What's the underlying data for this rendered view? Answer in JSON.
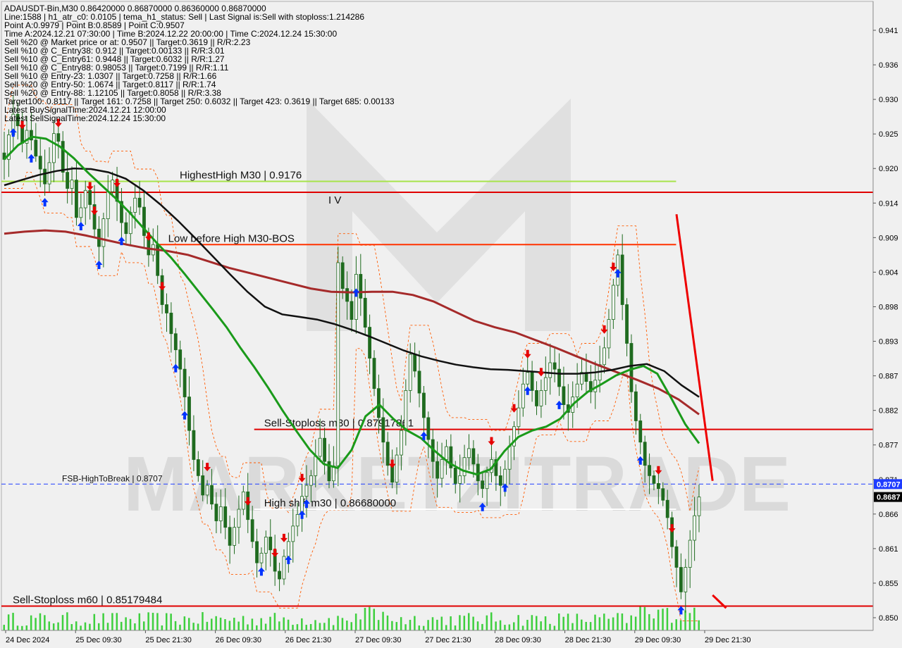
{
  "header": {
    "lines": [
      "ADAUSDT-Bin,M30  0.86420000 0.86870000 0.86360000 0.86870000",
      "Line:1588 | h1_atr_c0: 0.0105 | tema_h1_status: Sell | Last Signal is:Sell with stoploss:1.214286",
      "Point A:0.9979 | Point B:0.8589 | Point C:0.9507",
      "Time A:2024.12.21 07:30:00 | Time B:2024.12.22 20:00:00 | Time C:2024.12.24 15:30:00",
      "Sell %20 @ Market price or at: 0.9507 || Target:0.3619 || R/R:2.23",
      "Sell %10 @ C_Entry38: 0.912 || Target:0.00133 || R/R:3.01",
      "Sell %10 @ C_Entry61: 0.9448 || Target:0.6032 || R/R:1.27",
      "Sell %10 @ C_Entry88: 0.98053 || Target:0.7199 || R/R:1.11",
      "Sell %10 @ Entry-23: 1.0307 || Target:0.7258 || R/R:1.66",
      "Sell %20 @ Entry-50: 1.0674 || Target:0.8117 || R/R:1.74",
      "Sell %20 @ Entry-88: 1.12105 || Target:0.8058 || R/R:3.38",
      "Target100: 0.8117 || Target 161: 0.7258 || Target 250: 0.6032 || Target 423: 0.3619 || Target 685: 0.00133",
      "Latest BuySignalTime:2024.12.21 12:00:00",
      "Latest SellSignalTime:2024.12.24 15:30:00"
    ]
  },
  "watermark": "MARKETZITRADE",
  "chart_data": {
    "type": "candlestick",
    "symbol": "ADAUSDT-Bin",
    "timeframe": "M30",
    "ylim": [
      0.848,
      0.9455
    ],
    "y_ticks": [
      "0.941",
      "0.936",
      "0.930",
      "0.925",
      "0.920",
      "0.914",
      "0.909",
      "0.904",
      "0.898",
      "0.893",
      "0.887",
      "0.882",
      "0.877",
      "0.871",
      "0.866",
      "0.861",
      "0.855",
      "0.850"
    ],
    "x_ticks": [
      "24 Dec 2024",
      "25 Dec 09:30",
      "25 Dec 21:30",
      "26 Dec 09:30",
      "26 Dec 21:30",
      "27 Dec 09:30",
      "27 Dec 21:30",
      "28 Dec 09:30",
      "28 Dec 21:30",
      "29 Dec 09:30",
      "29 Dec 21:30"
    ],
    "price_badges": [
      {
        "label": "0.8707",
        "value": 0.8707,
        "color": "#1e3cff"
      },
      {
        "label": "0.8687",
        "value": 0.8687,
        "color": "#000000"
      }
    ],
    "levels": [
      {
        "label": "HighestHigh   M30 | 0.9176",
        "value": 0.9176,
        "color": "#a6e34a",
        "x_from": 0.0,
        "x_to": 0.774
      },
      {
        "label": "",
        "value": 0.9159,
        "color": "#e00000",
        "x_from": 0.0,
        "x_to": 1.0
      },
      {
        "label": "Low before High   M30-BOS",
        "value": 0.9078,
        "color": "#ff3300",
        "x_from": 0.18,
        "x_to": 0.774
      },
      {
        "label": "Sell-Stoploss m30 | 0.87917861",
        "value": 0.87917861,
        "color": "#e00000",
        "x_from": 0.29,
        "x_to": 1.0
      },
      {
        "label": "FSB-HighToBreak | 0.8707",
        "value": 0.8707,
        "color": "#1e3cff",
        "x_from": 0.0,
        "x_to": 1.0
      },
      {
        "label": "High shift m30 | 0.86680000",
        "value": 0.8668,
        "color": "#ffffff",
        "x_from": 0.29,
        "x_to": 0.774
      },
      {
        "label": "Sell-Stoploss m60 | 0.85179484",
        "value": 0.85179484,
        "color": "#e00000",
        "x_from": 0.0,
        "x_to": 1.0
      }
    ],
    "annotation": "I V",
    "closes": [
      0.921,
      0.9248,
      0.928,
      0.9262,
      0.9235,
      0.9255,
      0.924,
      0.9215,
      0.9195,
      0.9172,
      0.9205,
      0.925,
      0.9238,
      0.919,
      0.9165,
      0.9178,
      0.912,
      0.9135,
      0.9162,
      0.914,
      0.9102,
      0.9075,
      0.9118,
      0.916,
      0.9178,
      0.9145,
      0.9112,
      0.9095,
      0.9128,
      0.915,
      0.9136,
      0.9092,
      0.9062,
      0.9078,
      0.903,
      0.8985,
      0.8972,
      0.894,
      0.8915,
      0.8885,
      0.8842,
      0.879,
      0.8745,
      0.872,
      0.869,
      0.8705,
      0.8676,
      0.865,
      0.8672,
      0.864,
      0.8612,
      0.864,
      0.8668,
      0.8695,
      0.8652,
      0.8618,
      0.8585,
      0.86,
      0.8625,
      0.8605,
      0.8572,
      0.856,
      0.8595,
      0.8618,
      0.8642,
      0.866,
      0.8688,
      0.8705,
      0.872,
      0.875,
      0.8778,
      0.8742,
      0.8712,
      0.8735,
      0.905,
      0.901,
      0.899,
      0.8962,
      0.9032,
      0.8995,
      0.895,
      0.8902,
      0.8855,
      0.881,
      0.8772,
      0.8736,
      0.871,
      0.8752,
      0.879,
      0.8852,
      0.8908,
      0.8882,
      0.8848,
      0.881,
      0.8776,
      0.8742,
      0.8716,
      0.8745,
      0.8765,
      0.8732,
      0.8708,
      0.872,
      0.8748,
      0.8762,
      0.8738,
      0.8712,
      0.87,
      0.8725,
      0.8745,
      0.872,
      0.8705,
      0.873,
      0.8766,
      0.8796,
      0.8825,
      0.8862,
      0.888,
      0.8852,
      0.8828,
      0.8852,
      0.8872,
      0.8895,
      0.8885,
      0.8858,
      0.883,
      0.8818,
      0.8842,
      0.8862,
      0.888,
      0.8866,
      0.885,
      0.8868,
      0.8892,
      0.8918,
      0.8962,
      0.9015,
      0.9062,
      0.8985,
      0.8925,
      0.885,
      0.8805,
      0.8772,
      0.8736,
      0.872,
      0.8708,
      0.87,
      0.8682,
      0.8655,
      0.861,
      0.8578,
      0.854,
      0.8578,
      0.862,
      0.8658,
      0.8687
    ],
    "ma_fast_green": [
      0.921,
      0.9232,
      0.9245,
      0.9242,
      0.923,
      0.9212,
      0.919,
      0.917,
      0.915,
      0.9128,
      0.9104,
      0.908,
      0.9058,
      0.9032,
      0.9005,
      0.8978,
      0.895,
      0.8918,
      0.8888,
      0.8856,
      0.8822,
      0.879,
      0.876,
      0.8738,
      0.8732,
      0.876,
      0.8812,
      0.883,
      0.8808,
      0.879,
      0.8778,
      0.8758,
      0.874,
      0.8728,
      0.8722,
      0.873,
      0.8758,
      0.878,
      0.879,
      0.8796,
      0.8808,
      0.8832,
      0.885,
      0.8862,
      0.8875,
      0.8884,
      0.889,
      0.8878,
      0.884,
      0.88,
      0.877
    ],
    "ma_mid_black": [
      0.917,
      0.9178,
      0.9186,
      0.9192,
      0.9196,
      0.9195,
      0.919,
      0.918,
      0.9162,
      0.914,
      0.9115,
      0.9088,
      0.906,
      0.9032,
      0.9005,
      0.8982,
      0.897,
      0.8966,
      0.8962,
      0.8955,
      0.8946,
      0.8936,
      0.8925,
      0.8914,
      0.8905,
      0.8898,
      0.8892,
      0.8888,
      0.8885,
      0.8884,
      0.8882,
      0.888,
      0.8878,
      0.8878,
      0.888,
      0.8884,
      0.889,
      0.8893,
      0.8882,
      0.886,
      0.8842
    ],
    "ma_slow_brown": [
      0.9095,
      0.9098,
      0.91,
      0.9098,
      0.9092,
      0.9085,
      0.9078,
      0.9072,
      0.9068,
      0.9062,
      0.9052,
      0.9042,
      0.9034,
      0.9026,
      0.9018,
      0.901,
      0.9005,
      0.9004,
      0.9005,
      0.9005,
      0.9,
      0.899,
      0.8975,
      0.896,
      0.895,
      0.8942,
      0.893,
      0.8918,
      0.8905,
      0.8892,
      0.888,
      0.8868,
      0.8855,
      0.8838,
      0.8815
    ],
    "red_trend_line": [
      {
        "i": 149,
        "v": 0.9125
      },
      {
        "i": 157,
        "v": 0.8712
      }
    ],
    "red_small_line": [
      {
        "i": 157,
        "v": 0.8535
      },
      {
        "i": 160,
        "v": 0.8515
      }
    ],
    "buy_arrows": [
      2,
      6,
      9,
      17,
      21,
      26,
      38,
      40,
      57,
      63,
      66,
      67,
      78,
      93,
      106,
      111,
      116,
      123,
      136,
      141,
      150,
      163
    ],
    "sell_arrows": [
      4,
      12,
      19,
      20,
      25,
      32,
      35,
      45,
      54,
      60,
      62,
      66,
      86,
      108,
      113,
      116,
      119,
      133,
      135,
      145,
      148,
      158
    ]
  }
}
